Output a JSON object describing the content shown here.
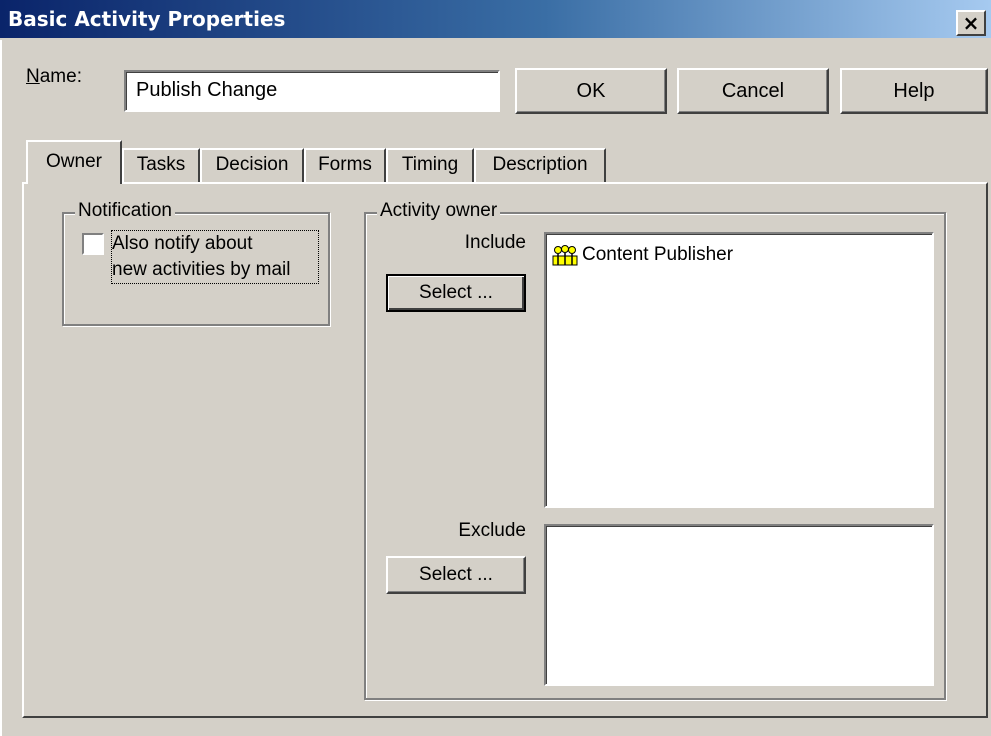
{
  "window": {
    "title": "Basic Activity Properties",
    "close_glyph": "×"
  },
  "name": {
    "label": "Name:",
    "value": "Publish Change"
  },
  "buttons": {
    "ok": "OK",
    "cancel": "Cancel",
    "help": "Help"
  },
  "tabs": [
    {
      "label": "Owner",
      "active": true
    },
    {
      "label": "Tasks",
      "active": false
    },
    {
      "label": "Decision",
      "active": false
    },
    {
      "label": "Forms",
      "active": false
    },
    {
      "label": "Timing",
      "active": false
    },
    {
      "label": "Description",
      "active": false
    }
  ],
  "notification": {
    "legend": "Notification",
    "checkbox_label_line1": "Also notify about",
    "checkbox_label_line2": "new activities by mail",
    "checked": false
  },
  "activity_owner": {
    "legend": "Activity owner",
    "include_label": "Include",
    "exclude_label": "Exclude",
    "select_label": "Select ...",
    "include_items": [
      {
        "icon": "group-icon",
        "label": "Content Publisher"
      }
    ],
    "exclude_items": []
  }
}
